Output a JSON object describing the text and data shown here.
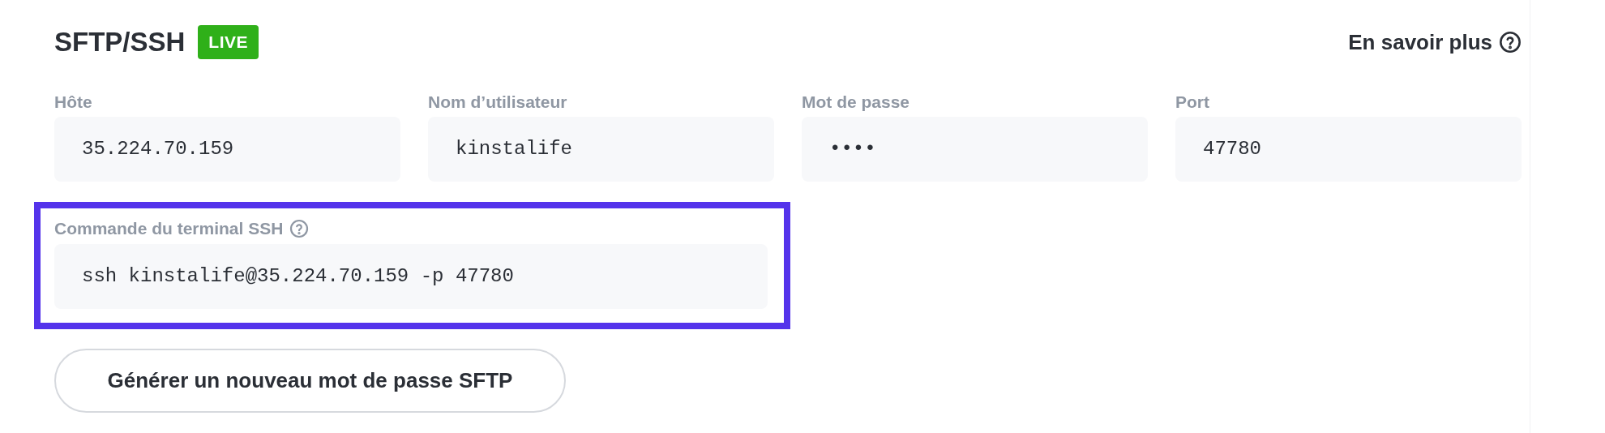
{
  "header": {
    "title": "SFTP/SSH",
    "badge": "LIVE",
    "help_link": "En savoir plus"
  },
  "fields": [
    {
      "label": "Hôte",
      "value": "35.224.70.159"
    },
    {
      "label": "Nom d’utilisateur",
      "value": "kinstalife"
    },
    {
      "label": "Mot de passe",
      "value": "••••"
    },
    {
      "label": "Port",
      "value": "47780"
    }
  ],
  "ssh_command": {
    "label": "Commande du terminal SSH",
    "value": "ssh kinstalife@35.224.70.159 -p 47780",
    "highlighted": true
  },
  "button": "Générer un nouveau mot de passe SFTP"
}
